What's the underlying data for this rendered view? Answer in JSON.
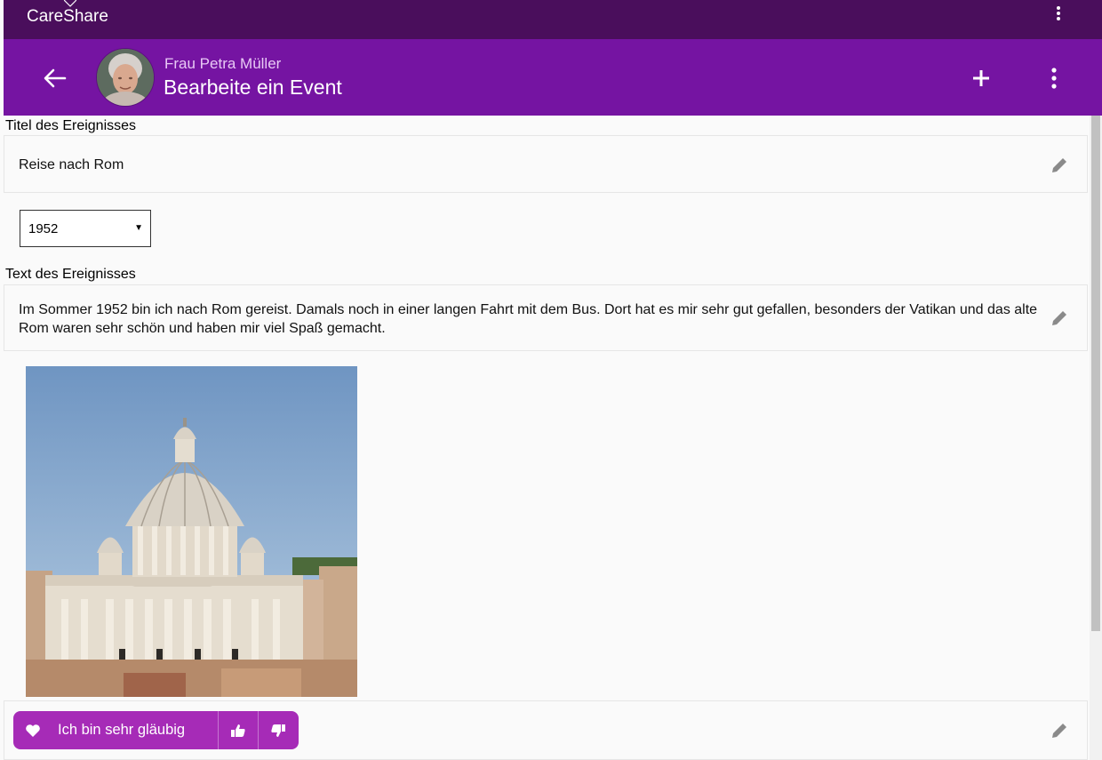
{
  "app": {
    "name": "CareShare"
  },
  "toolbar": {
    "person_name": "Frau Petra Müller",
    "page_title": "Bearbeite ein Event"
  },
  "event": {
    "title_label": "Titel des Ereignisses",
    "title_value": "Reise nach Rom",
    "year": "1952",
    "text_label": "Text des Ereignisses",
    "text_value": "Im Sommer 1952 bin ich nach Rom gereist. Damals noch in einer langen Fahrt mit dem Bus. Dort hat es mir sehr gut gefallen, besonders der Vatikan und das alte Rom waren sehr schön und haben mir viel Spaß gemacht."
  },
  "tag_chip": {
    "label": "Ich bin sehr gläubig"
  },
  "colors": {
    "status_bar": "#4a0e5c",
    "toolbar": "#7514a2",
    "chip": "#a62bb7"
  }
}
